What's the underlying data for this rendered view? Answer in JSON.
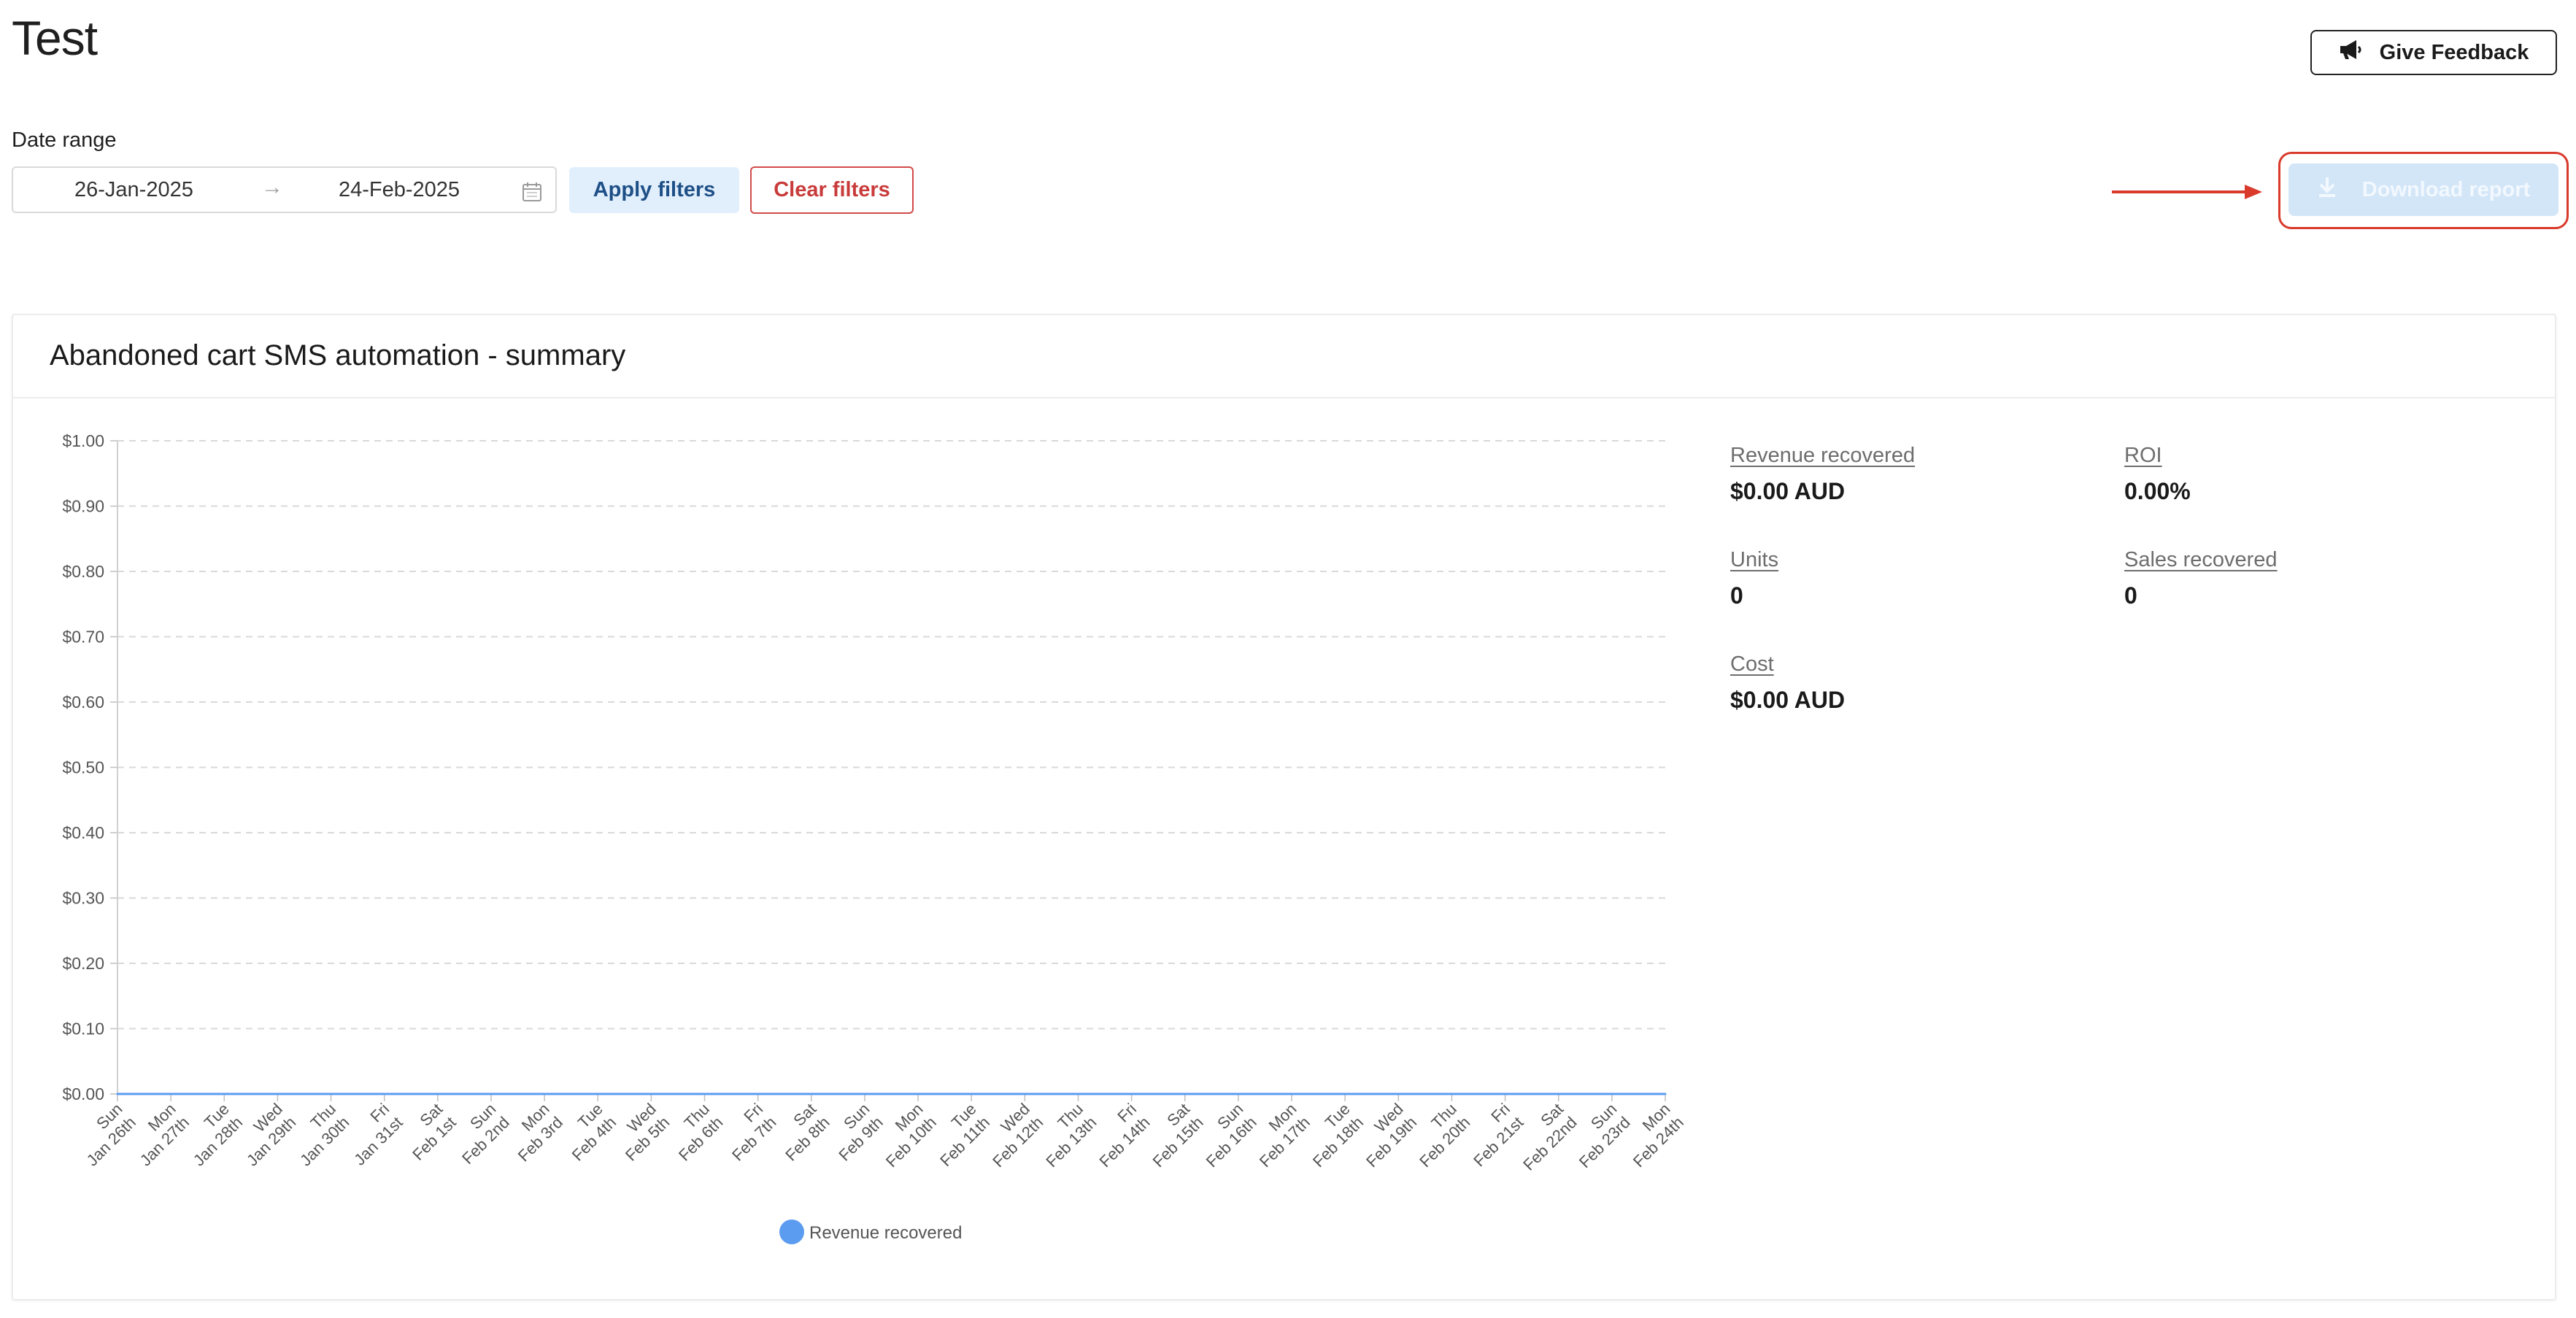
{
  "page": {
    "title": "Test"
  },
  "feedback": {
    "label": "Give Feedback",
    "icon": "megaphone-icon"
  },
  "filters": {
    "date_range_label": "Date range",
    "start_date": "26-Jan-2025",
    "arrow": "→",
    "end_date": "24-Feb-2025",
    "apply_label": "Apply filters",
    "clear_label": "Clear filters"
  },
  "download": {
    "label": "Download report",
    "icon": "download-icon",
    "state": "disabled"
  },
  "annotation": {
    "color": "#d93a2b"
  },
  "card": {
    "title": "Abandoned cart SMS automation - summary"
  },
  "metrics": [
    {
      "label": "Revenue recovered",
      "value": "$0.00 AUD"
    },
    {
      "label": "ROI",
      "value": "0.00%"
    },
    {
      "label": "Units",
      "value": "0"
    },
    {
      "label": "Sales recovered",
      "value": "0"
    },
    {
      "label": "Cost",
      "value": "$0.00 AUD"
    }
  ],
  "chart_data": {
    "type": "line",
    "title": "",
    "xlabel": "",
    "ylabel": "",
    "ylim": [
      0,
      1
    ],
    "y_ticks": [
      "$0.00",
      "$0.10",
      "$0.20",
      "$0.30",
      "$0.40",
      "$0.50",
      "$0.60",
      "$0.70",
      "$0.80",
      "$0.90",
      "$1.00"
    ],
    "grid": true,
    "legend_position": "bottom-center",
    "categories": [
      [
        "Sun",
        "Jan 26th"
      ],
      [
        "Mon",
        "Jan 27th"
      ],
      [
        "Tue",
        "Jan 28th"
      ],
      [
        "Wed",
        "Jan 29th"
      ],
      [
        "Thu",
        "Jan 30th"
      ],
      [
        "Fri",
        "Jan 31st"
      ],
      [
        "Sat",
        "Feb 1st"
      ],
      [
        "Sun",
        "Feb 2nd"
      ],
      [
        "Mon",
        "Feb 3rd"
      ],
      [
        "Tue",
        "Feb 4th"
      ],
      [
        "Wed",
        "Feb 5th"
      ],
      [
        "Thu",
        "Feb 6th"
      ],
      [
        "Fri",
        "Feb 7th"
      ],
      [
        "Sat",
        "Feb 8th"
      ],
      [
        "Sun",
        "Feb 9th"
      ],
      [
        "Mon",
        "Feb 10th"
      ],
      [
        "Tue",
        "Feb 11th"
      ],
      [
        "Wed",
        "Feb 12th"
      ],
      [
        "Thu",
        "Feb 13th"
      ],
      [
        "Fri",
        "Feb 14th"
      ],
      [
        "Sat",
        "Feb 15th"
      ],
      [
        "Sun",
        "Feb 16th"
      ],
      [
        "Mon",
        "Feb 17th"
      ],
      [
        "Tue",
        "Feb 18th"
      ],
      [
        "Wed",
        "Feb 19th"
      ],
      [
        "Thu",
        "Feb 20th"
      ],
      [
        "Fri",
        "Feb 21st"
      ],
      [
        "Sat",
        "Feb 22nd"
      ],
      [
        "Sun",
        "Feb 23rd"
      ],
      [
        "Mon",
        "Feb 24th"
      ]
    ],
    "series": [
      {
        "name": "Revenue recovered",
        "color": "#5b9cf0",
        "values": [
          0,
          0,
          0,
          0,
          0,
          0,
          0,
          0,
          0,
          0,
          0,
          0,
          0,
          0,
          0,
          0,
          0,
          0,
          0,
          0,
          0,
          0,
          0,
          0,
          0,
          0,
          0,
          0,
          0,
          0
        ]
      }
    ]
  }
}
